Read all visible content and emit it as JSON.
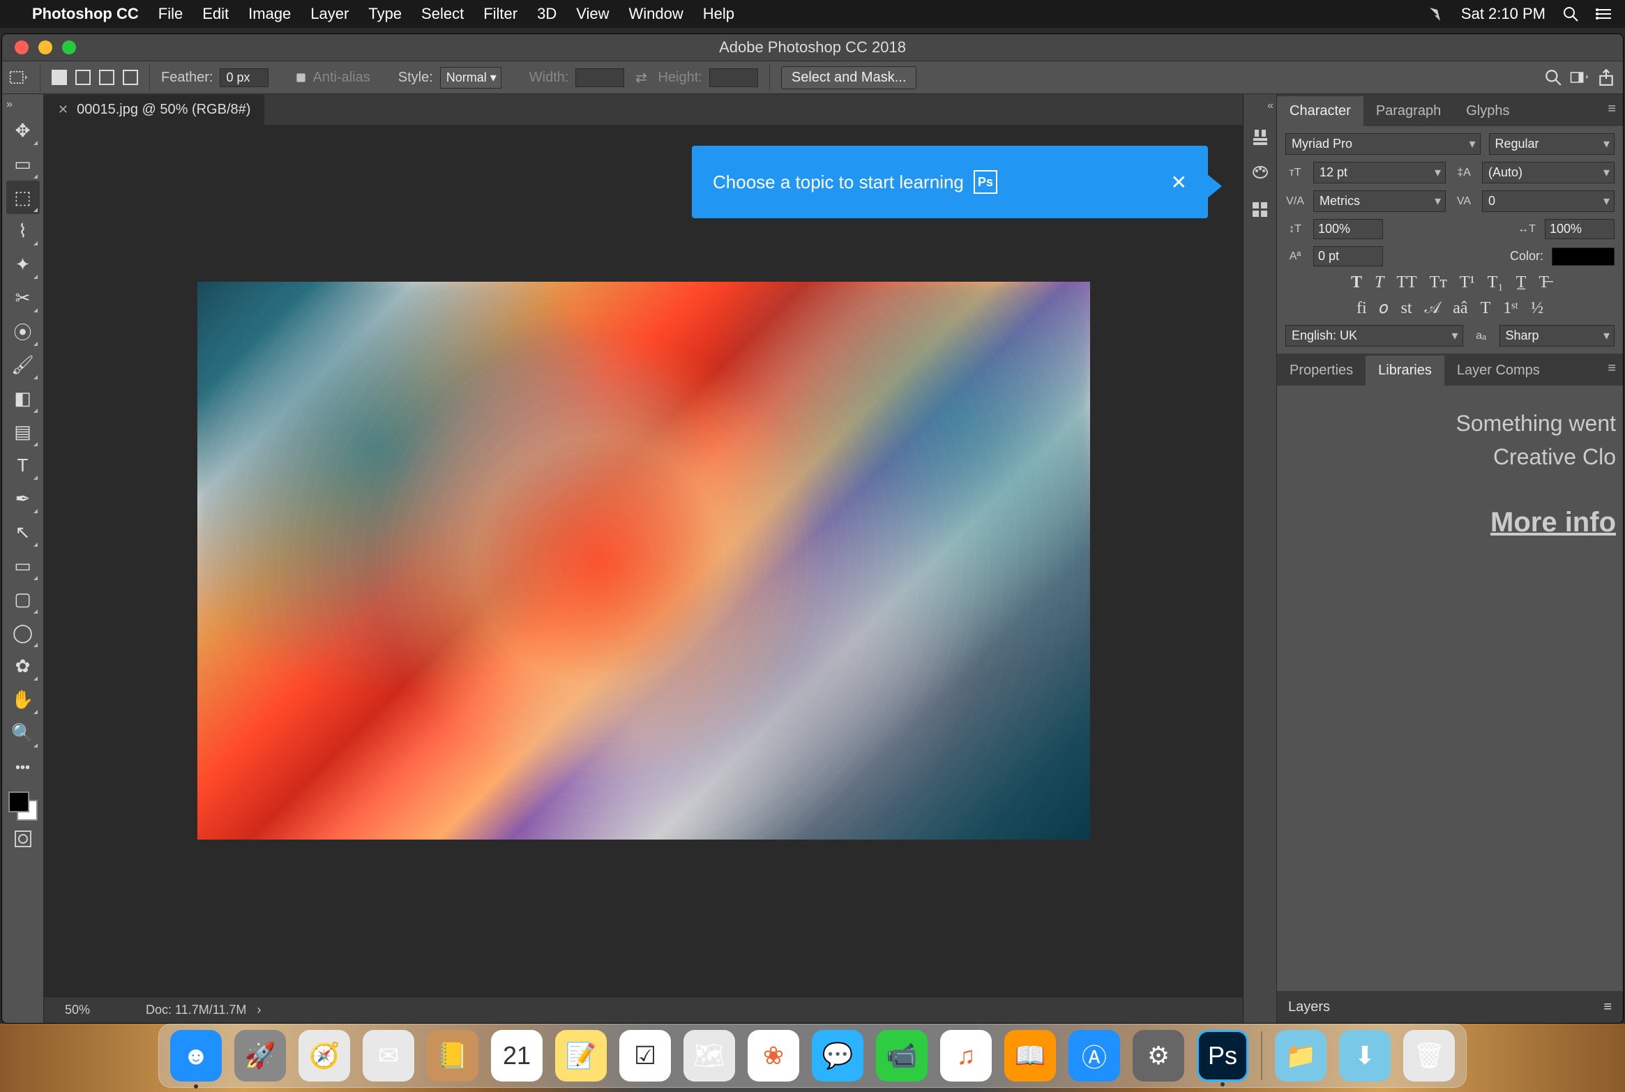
{
  "macos": {
    "app_name": "Photoshop CC",
    "menus": [
      "File",
      "Edit",
      "Image",
      "Layer",
      "Type",
      "Select",
      "Filter",
      "3D",
      "View",
      "Window",
      "Help"
    ],
    "clock": "Sat 2:10 PM"
  },
  "window_title": "Adobe Photoshop CC 2018",
  "options_bar": {
    "feather_label": "Feather:",
    "feather_value": "0 px",
    "antialias_label": "Anti-alias",
    "style_label": "Style:",
    "style_value": "Normal",
    "width_label": "Width:",
    "width_value": "",
    "height_label": "Height:",
    "height_value": "",
    "select_mask_btn": "Select and Mask..."
  },
  "document": {
    "tab_title": "00015.jpg @ 50% (RGB/8#)",
    "zoom": "50%",
    "doc_info": "Doc: 11.7M/11.7M"
  },
  "learn_tip": {
    "text": "Choose a topic to start learning",
    "badge": "Ps"
  },
  "tools": [
    {
      "name": "move",
      "glyph": "✥"
    },
    {
      "name": "artboard",
      "glyph": "▭"
    },
    {
      "name": "marquee",
      "glyph": "⬚",
      "selected": true
    },
    {
      "name": "lasso",
      "glyph": "⌇"
    },
    {
      "name": "quick-select",
      "glyph": "✦"
    },
    {
      "name": "crop",
      "glyph": "✂"
    },
    {
      "name": "eyedropper",
      "glyph": "⦿"
    },
    {
      "name": "brush",
      "glyph": "🖌"
    },
    {
      "name": "eraser",
      "glyph": "◧"
    },
    {
      "name": "gradient",
      "glyph": "▤"
    },
    {
      "name": "type",
      "glyph": "T"
    },
    {
      "name": "pen",
      "glyph": "✒"
    },
    {
      "name": "path-select",
      "glyph": "↖"
    },
    {
      "name": "rectangle",
      "glyph": "▭"
    },
    {
      "name": "rounded-rect",
      "glyph": "▢"
    },
    {
      "name": "ellipse",
      "glyph": "◯"
    },
    {
      "name": "custom-shape",
      "glyph": "✿"
    },
    {
      "name": "hand",
      "glyph": "✋"
    },
    {
      "name": "zoom",
      "glyph": "🔍"
    }
  ],
  "right_strip_icons": [
    "learn",
    "color",
    "swatches",
    "grid"
  ],
  "char_panel": {
    "tabs": [
      "Character",
      "Paragraph",
      "Glyphs"
    ],
    "active_tab": "Character",
    "font_family": "Myriad Pro",
    "font_style": "Regular",
    "font_size": "12 pt",
    "leading": "(Auto)",
    "kerning": "Metrics",
    "tracking": "0",
    "vert_scale": "100%",
    "horiz_scale": "100%",
    "baseline_shift": "0 pt",
    "color_label": "Color:",
    "color_value": "#000000",
    "type_buttons": [
      "T",
      "T",
      "TT",
      "Tт",
      "T¹",
      "T₁",
      "T̲",
      "T̶"
    ],
    "ot_buttons": [
      "fi",
      "𝑜",
      "st",
      "𝒜",
      "aâ",
      "T",
      "1ˢᵗ",
      "½"
    ],
    "language": "English: UK",
    "aa_icon": "aₐ",
    "antialiasing": "Sharp"
  },
  "lib_panel": {
    "tabs": [
      "Properties",
      "Libraries",
      "Layer Comps"
    ],
    "active_tab": "Libraries",
    "line1": "Something went",
    "line2": "Creative Clo",
    "more": "More info"
  },
  "layers_panel": {
    "title": "Layers"
  },
  "dock": {
    "apps": [
      {
        "name": "finder",
        "bg": "#1e90ff",
        "glyph": "☻",
        "running": true
      },
      {
        "name": "launchpad",
        "bg": "#888",
        "glyph": "🚀"
      },
      {
        "name": "safari",
        "bg": "#e8e8e8",
        "glyph": "🧭"
      },
      {
        "name": "mail",
        "bg": "#e8e8e8",
        "glyph": "✉"
      },
      {
        "name": "contacts",
        "bg": "#c8925a",
        "glyph": "📒"
      },
      {
        "name": "calendar",
        "bg": "#fff",
        "glyph": "21",
        "text_color": "#333"
      },
      {
        "name": "notes",
        "bg": "#ffe070",
        "glyph": "📝"
      },
      {
        "name": "reminders",
        "bg": "#fff",
        "glyph": "☑",
        "text_color": "#333"
      },
      {
        "name": "maps",
        "bg": "#e8e8e8",
        "glyph": "🗺"
      },
      {
        "name": "photos",
        "bg": "#fff",
        "glyph": "❀",
        "text_color": "#e63"
      },
      {
        "name": "messages",
        "bg": "#2bb3ff",
        "glyph": "💬"
      },
      {
        "name": "facetime",
        "bg": "#2ecc40",
        "glyph": "📹"
      },
      {
        "name": "itunes",
        "bg": "#fff",
        "glyph": "♫",
        "text_color": "#e63"
      },
      {
        "name": "ibooks",
        "bg": "#ff9500",
        "glyph": "📖"
      },
      {
        "name": "appstore",
        "bg": "#1e90ff",
        "glyph": "Ⓐ"
      },
      {
        "name": "preferences",
        "bg": "#666",
        "glyph": "⚙"
      },
      {
        "name": "photoshop",
        "bg": "#001e36",
        "glyph": "Ps",
        "running": true,
        "border": "3px solid #2bb3ff"
      }
    ],
    "right": [
      {
        "name": "applications-folder",
        "bg": "#7ac8e8",
        "glyph": "📁"
      },
      {
        "name": "downloads-folder",
        "bg": "#7ac8e8",
        "glyph": "⬇"
      },
      {
        "name": "trash",
        "bg": "#e8e8e8",
        "glyph": "🗑"
      }
    ]
  }
}
